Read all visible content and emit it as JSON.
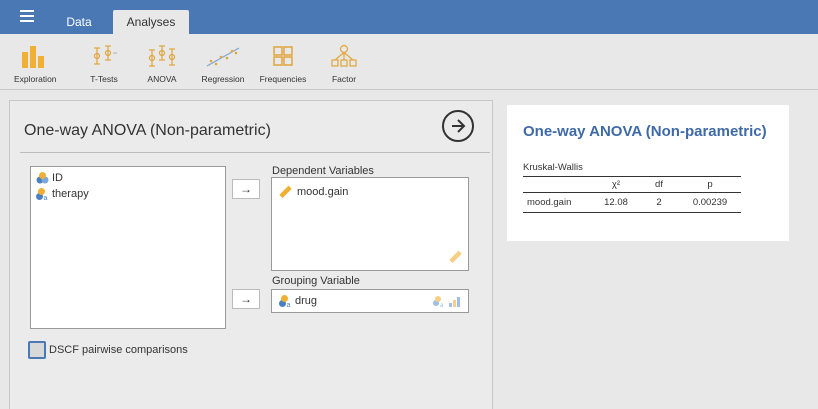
{
  "menu": {
    "tabs": [
      {
        "label": "Data"
      },
      {
        "label": "Analyses"
      }
    ],
    "active_tab": "Analyses"
  },
  "ribbon": {
    "items": [
      {
        "label": "Exploration",
        "icon": "exploration-icon"
      },
      {
        "label": "T-Tests",
        "icon": "t-tests-icon"
      },
      {
        "label": "ANOVA",
        "icon": "anova-icon"
      },
      {
        "label": "Regression",
        "icon": "regression-icon"
      },
      {
        "label": "Frequencies",
        "icon": "frequencies-icon"
      },
      {
        "label": "Factor",
        "icon": "factor-icon"
      }
    ]
  },
  "options": {
    "title": "One-way ANOVA (Non-parametric)",
    "variables": [
      {
        "name": "ID",
        "icon": "continuous-variable-icon"
      },
      {
        "name": "therapy",
        "icon": "nominal-variable-icon"
      }
    ],
    "dependent_label": "Dependent Variables",
    "dependent_vars": [
      {
        "name": "mood.gain",
        "icon": "ruler-icon"
      }
    ],
    "grouping_label": "Grouping Variable",
    "grouping_var": {
      "name": "drug",
      "icon": "nominal-variable-icon"
    },
    "arrow": "→",
    "checkbox_label": "DSCF pairwise comparisons",
    "checkbox_checked": false
  },
  "results": {
    "title": "One-way ANOVA (Non-parametric)",
    "subtitle": "Kruskal-Wallis",
    "columns": [
      "",
      "χ²",
      "df",
      "p"
    ],
    "rows": [
      [
        "mood.gain",
        "12.08",
        "2",
        "0.00239"
      ]
    ]
  },
  "colors": {
    "accent": "#4a78b5",
    "title_blue": "#3e6aa8",
    "icon_orange": "#f0b035"
  }
}
